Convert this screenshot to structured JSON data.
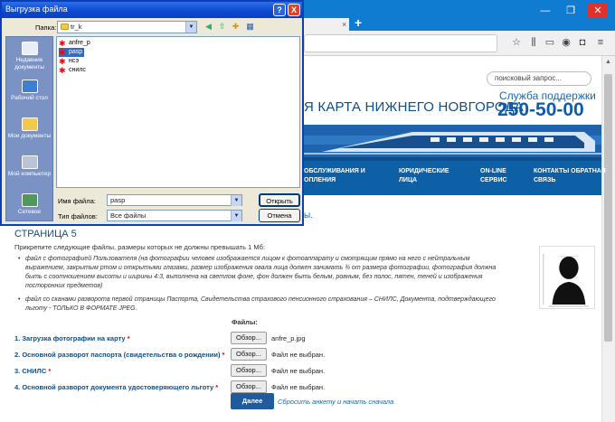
{
  "browser": {
    "new_tab": "+",
    "window_controls": [
      "—",
      "❐",
      "✕"
    ],
    "tab_close": "×",
    "scroll_up": "▲"
  },
  "site": {
    "search_placeholder": "поисковый запрос...",
    "title": "Я КАРТА НИЖНЕГО НОВГОРОДА",
    "support_label": "Служба поддержки",
    "support_phone": "250-50-00",
    "nav": [
      {
        "line1": "ОБСЛУЖИВАНИЯ И",
        "line2": "ОПЛЕНИЯ"
      },
      {
        "line1": "ЮРИДИЧЕСКИЕ",
        "line2": "ЛИЦА"
      },
      {
        "line1": "ON-LINE",
        "line2": "СЕРВИС"
      },
      {
        "line1": "КОНТАКТЫ ОБРАТНАЯ",
        "line2": "СВЯЗЬ"
      }
    ],
    "breadcrumb_tail": "ы."
  },
  "page": {
    "heading": "СТРАНИЦА 5",
    "intro": "Прикрепите следующие файлы, размеры которых не должны превышать 1 Мб:",
    "bullet1_lines": [
      "файл с фотографией Пользователя (на фотографии человек изображается лицом к фотоаппарату и смотрящим прямо на него с нейтральным",
      "выражением, закрытым ртом и открытыми глазами, размер изображения овала лица должен занимать ¾ от размера фотографии, фотография должна",
      "быть с соотношением высоты и ширины 4:3, выполнена на светлом фоне, фон должен быть белым, ровным, без полос, пятен, теней и изображения",
      "посторонних предметов)"
    ],
    "bullet2_lines": [
      "файл со сканами разворота первой страницы Паспорта, Свидетельства страхового пенсионного страхования – СНИЛС, Документа, подтверждающего",
      "льготу - ТОЛЬКО В ФОРМАТЕ JPEG."
    ],
    "files_header": "Файлы:",
    "rows": [
      {
        "label": "1. Загрузка фотографии на карту",
        "button": "Обзор...",
        "status": "anfre_p.jpg"
      },
      {
        "label": "2. Основной разворот паспорта (свидетельства о рождении)",
        "button": "Обзор...",
        "status": "Файл не выбран."
      },
      {
        "label": "3. СНИЛС",
        "button": "Обзор...",
        "status": "Файл не выбран."
      },
      {
        "label": "4. Основной разворот документа удостоверяющего льготу",
        "button": "Обзор...",
        "status": "Файл не выбран."
      }
    ],
    "required_mark": "*",
    "next_button": "Далее",
    "reset_link": "Сбросить анкету и начать сначала"
  },
  "dialog": {
    "title": "Выгрузка файла",
    "help_btn": "?",
    "close_btn": "X",
    "folder_label": "Папка:",
    "folder_value": "tr_k",
    "places": [
      "Недавние документы",
      "Рабочий стол",
      "Мои документы",
      "Мой компьютер",
      "Сетевое"
    ],
    "files": [
      "anfre_p",
      "pasp",
      "нсэ",
      "снилс"
    ],
    "selected_file_index": 1,
    "filename_label": "Имя файла:",
    "filename_value": "pasp",
    "filetype_label": "Тип файлов:",
    "filetype_value": "Все файлы",
    "open_button": "Открыть",
    "cancel_button": "Отмена"
  }
}
